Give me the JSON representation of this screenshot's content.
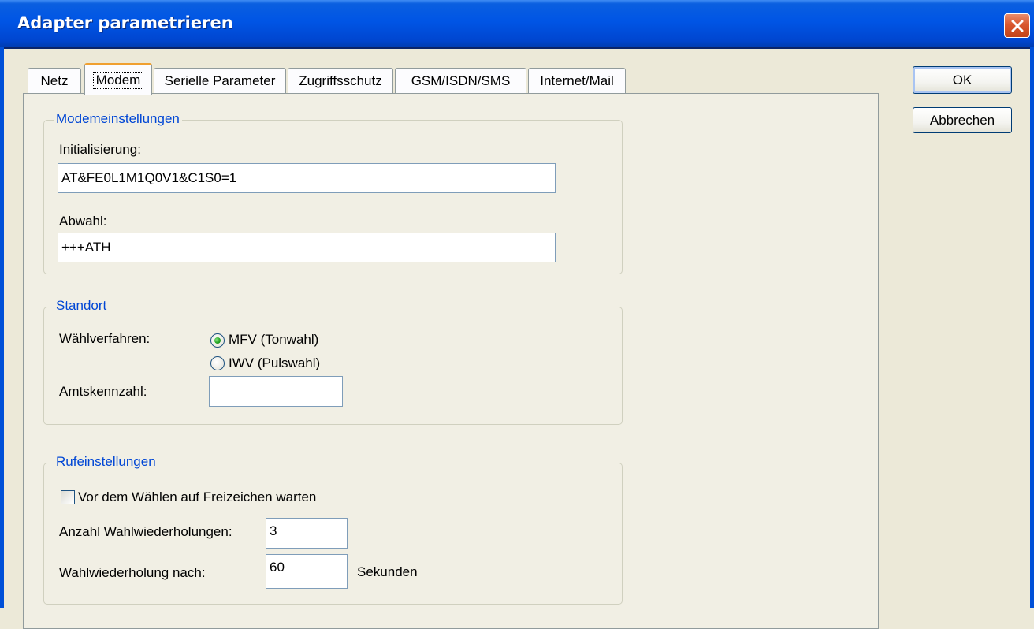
{
  "window": {
    "title": "Adapter parametrieren"
  },
  "tabs": [
    {
      "label": "Netz"
    },
    {
      "label": "Modem"
    },
    {
      "label": "Serielle Parameter"
    },
    {
      "label": "Zugriffsschutz"
    },
    {
      "label": "GSM/ISDN/SMS"
    },
    {
      "label": "Internet/Mail"
    }
  ],
  "active_tab": "Modem",
  "buttons": {
    "ok": "OK",
    "cancel": "Abbrechen"
  },
  "modem_settings": {
    "legend": "Modemeinstellungen",
    "init_label": "Initialisierung:",
    "init_value": "AT&FE0L1M1Q0V1&C1S0=1",
    "hangup_label": "Abwahl:",
    "hangup_value": "+++ATH"
  },
  "location": {
    "legend": "Standort",
    "dial_method_label": "Wählverfahren:",
    "options": [
      {
        "label": "MFV (Tonwahl)",
        "selected": true
      },
      {
        "label": "IWV (Pulswahl)",
        "selected": false
      }
    ],
    "outside_line_label": "Amtskennzahl:",
    "outside_line_value": ""
  },
  "call_settings": {
    "legend": "Rufeinstellungen",
    "wait_dialtone_label": "Vor dem Wählen auf Freizeichen warten",
    "wait_dialtone_checked": false,
    "redial_count_label": "Anzahl Wahlwiederholungen:",
    "redial_count_value": "3",
    "redial_after_label": "Wahlwiederholung nach:",
    "redial_after_value": "60",
    "redial_after_unit": "Sekunden"
  },
  "colors": {
    "titlebar": "#0055e5",
    "dialog_bg": "#ece9d8",
    "group_legend": "#0046d5",
    "close_button": "#d9582f"
  }
}
